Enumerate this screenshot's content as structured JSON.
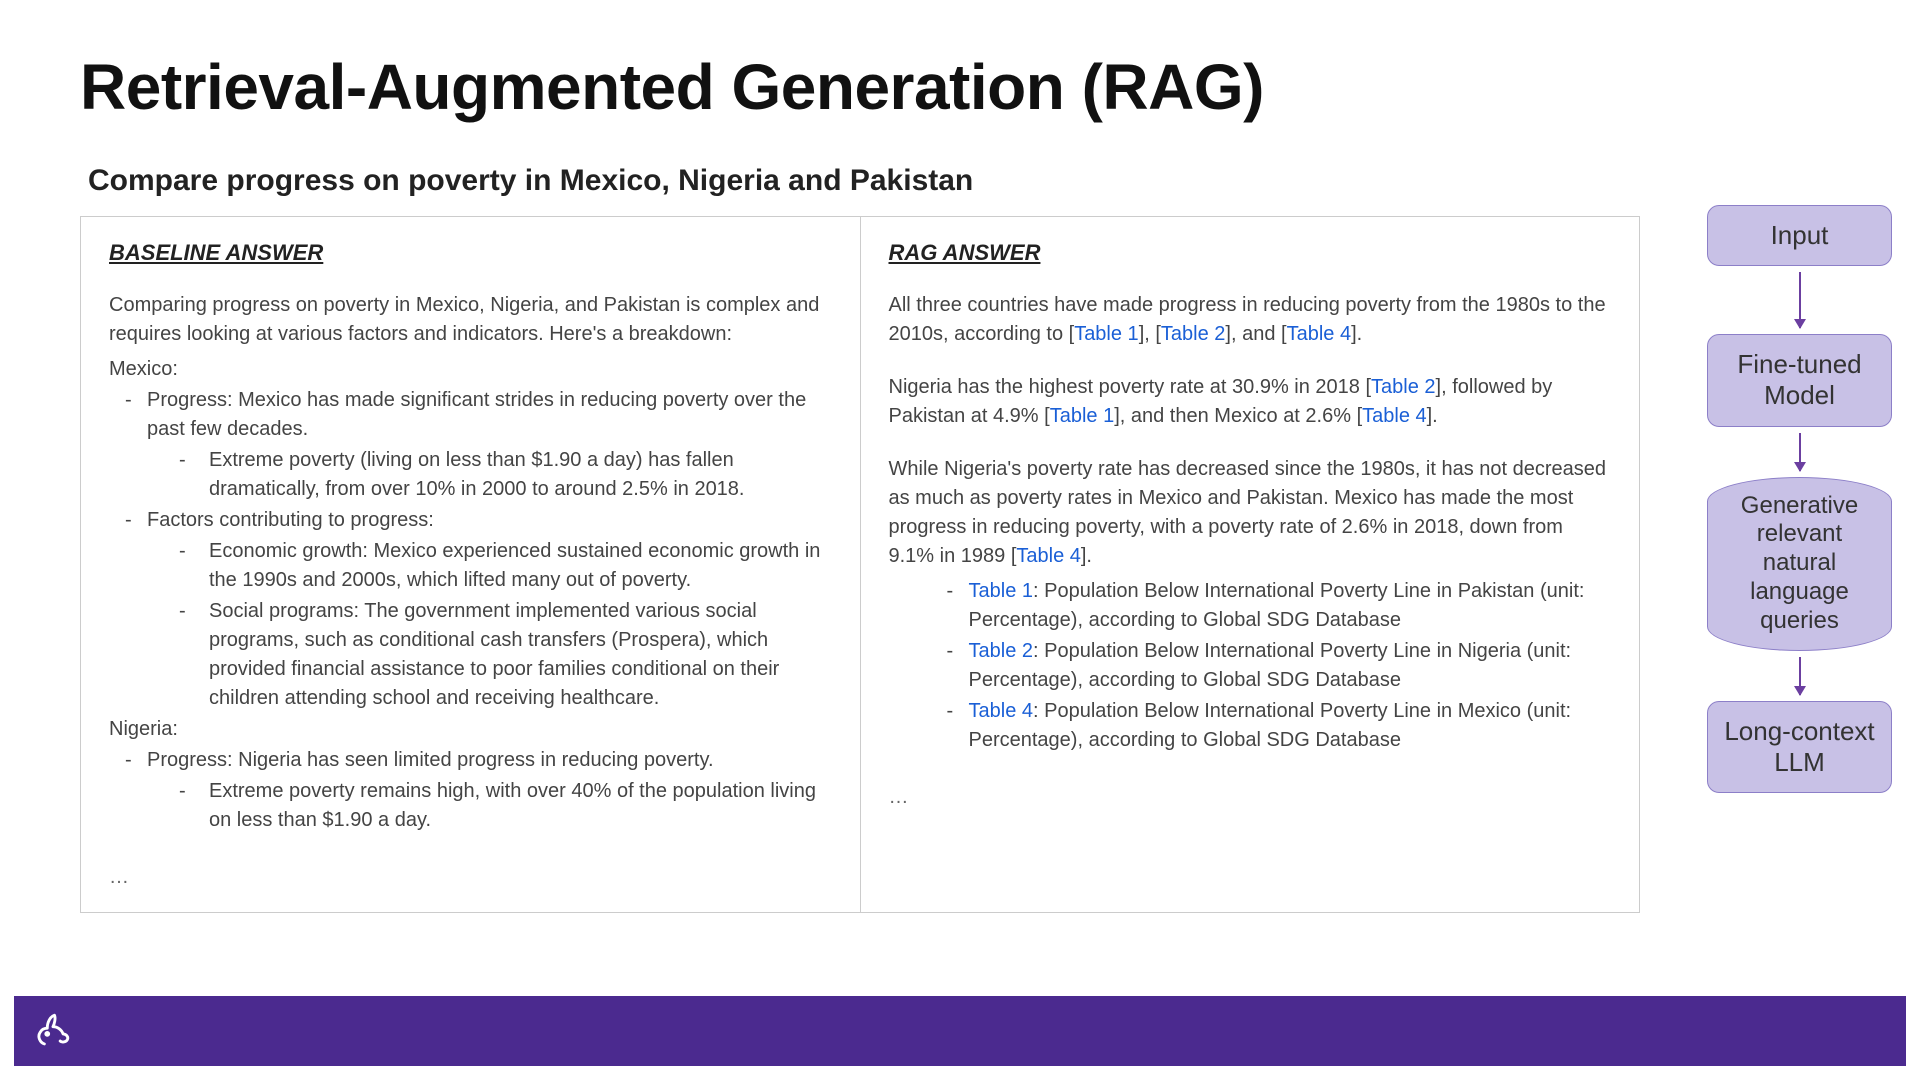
{
  "title": "Retrieval-Augmented Generation (RAG)",
  "subtitle": "Compare progress on poverty in Mexico, Nigeria and Pakistan",
  "baseline": {
    "heading": "BASELINE ANSWER",
    "intro": "Comparing progress on poverty in Mexico, Nigeria, and Pakistan is complex and requires looking at various factors and indicators. Here's a breakdown:",
    "mexico_head": "Mexico:",
    "mexico_progress": "Progress: Mexico has made significant strides in reducing poverty over the past few decades.",
    "mexico_sub1": "Extreme poverty (living on less than $1.90 a day) has fallen dramatically, from over 10% in 2000 to around 2.5% in 2018.",
    "mexico_factors_head": "Factors contributing to progress:",
    "mexico_factor1": "Economic growth: Mexico experienced sustained economic growth in the 1990s and 2000s, which lifted many out of poverty.",
    "mexico_factor2": "Social programs: The government implemented various social programs, such as conditional cash transfers (Prospera), which provided financial assistance to poor families conditional on their children attending school and receiving healthcare.",
    "nigeria_head": "Nigeria:",
    "nigeria_progress": "Progress: Nigeria has seen limited progress in reducing poverty.",
    "nigeria_sub1": "Extreme poverty remains high, with over 40% of the population living on less than $1.90 a day.",
    "ellipsis": "…"
  },
  "rag": {
    "heading": "RAG ANSWER",
    "p1_pre": "All three countries have made progress in reducing poverty from the 1980s to the 2010s, according to [",
    "t1": "Table 1",
    "p1_mid1": "], [",
    "t2": "Table 2",
    "p1_mid2": "], and [",
    "t4a": "Table 4",
    "p1_post": "].",
    "p2_pre": "Nigeria has the highest poverty rate at 30.9% in 2018 [",
    "t2b": "Table 2",
    "p2_mid1": "], followed by Pakistan at 4.9% [",
    "t1b": "Table 1",
    "p2_mid2": "], and then Mexico at 2.6% [",
    "t4b": "Table 4",
    "p2_post": "].",
    "p3_pre": "While Nigeria's poverty rate has decreased since the 1980s, it has not decreased as much as poverty rates in Mexico and Pakistan. Mexico has made the most progress in reducing poverty, with a poverty rate of 2.6% in 2018, down from 9.1% in 1989 [",
    "t4c": "Table 4",
    "p3_post": "].",
    "li1_link": "Table 1",
    "li1_rest": ": Population Below International Poverty Line in Pakistan (unit: Percentage), according to Global SDG Database",
    "li2_link": "Table 2",
    "li2_rest": ": Population Below International Poverty Line in Nigeria (unit: Percentage), according to Global SDG Database",
    "li3_link": "Table 4",
    "li3_rest": ": Population Below International Poverty Line in Mexico (unit: Percentage), according to Global SDG Database",
    "ellipsis": "…"
  },
  "flow": {
    "b1": "Input",
    "b2": "Fine-tuned Model",
    "b3": "Generative relevant natural language queries",
    "b4": "Long-context LLM"
  }
}
